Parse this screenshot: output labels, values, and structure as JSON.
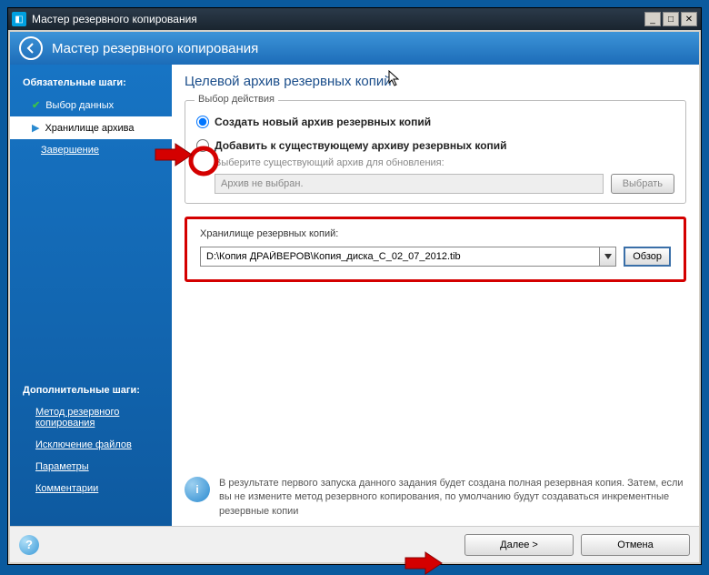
{
  "window": {
    "title": "Мастер резервного копирования"
  },
  "header": {
    "title": "Мастер резервного копирования"
  },
  "sidebar": {
    "required_heading": "Обязательные шаги:",
    "items": [
      {
        "label": "Выбор данных",
        "icon": "check"
      },
      {
        "label": "Хранилище архива",
        "icon": "arrow"
      },
      {
        "label": "Завершение",
        "icon": ""
      }
    ],
    "optional_heading": "Дополнительные шаги:",
    "optional_items": [
      {
        "label": "Метод резервного копирования"
      },
      {
        "label": "Исключение файлов"
      },
      {
        "label": "Параметры"
      },
      {
        "label": "Комментарии"
      }
    ]
  },
  "main": {
    "title": "Целевой архив резервных копий",
    "action_legend": "Выбор действия",
    "radio_create": "Создать новый архив резервных копий",
    "radio_append": "Добавить к существующему архиву резервных копий",
    "append_sub": "Выберите существующий архив для обновления:",
    "archive_placeholder": "Архив не выбран.",
    "select_btn": "Выбрать",
    "storage_label": "Хранилище резервных копий:",
    "storage_value": "D:\\Копия ДРАЙВЕРОВ\\Копия_диска_C_02_07_2012.tib",
    "browse_btn": "Обзор",
    "info_text": "В результате первого запуска данного задания будет создана полная резервная копия. Затем, если вы не измените метод резервного копирования, по умолчанию будут создаваться инкрементные резервные копии"
  },
  "footer": {
    "next": "Далее >",
    "cancel": "Отмена"
  }
}
